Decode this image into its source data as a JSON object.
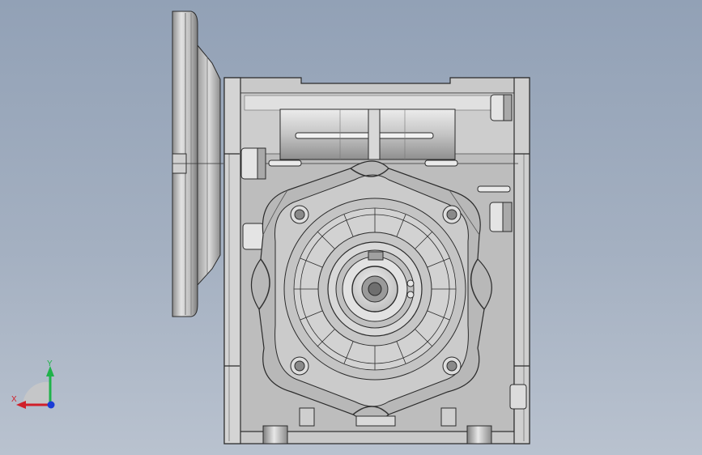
{
  "viewport": {
    "background_top": "#92a1b6",
    "background_bottom": "#b9c2cf"
  },
  "model": {
    "part": "worm-gear-reducer",
    "body_color": "#d6d6d6",
    "shade_color": "#a9a9a9",
    "edge_color": "#2b2b2b"
  },
  "triad": {
    "x_label": "X",
    "y_label": "Y",
    "x_color": "#d0202a",
    "y_color": "#1fb24a",
    "z_color": "#1a3cd6"
  }
}
